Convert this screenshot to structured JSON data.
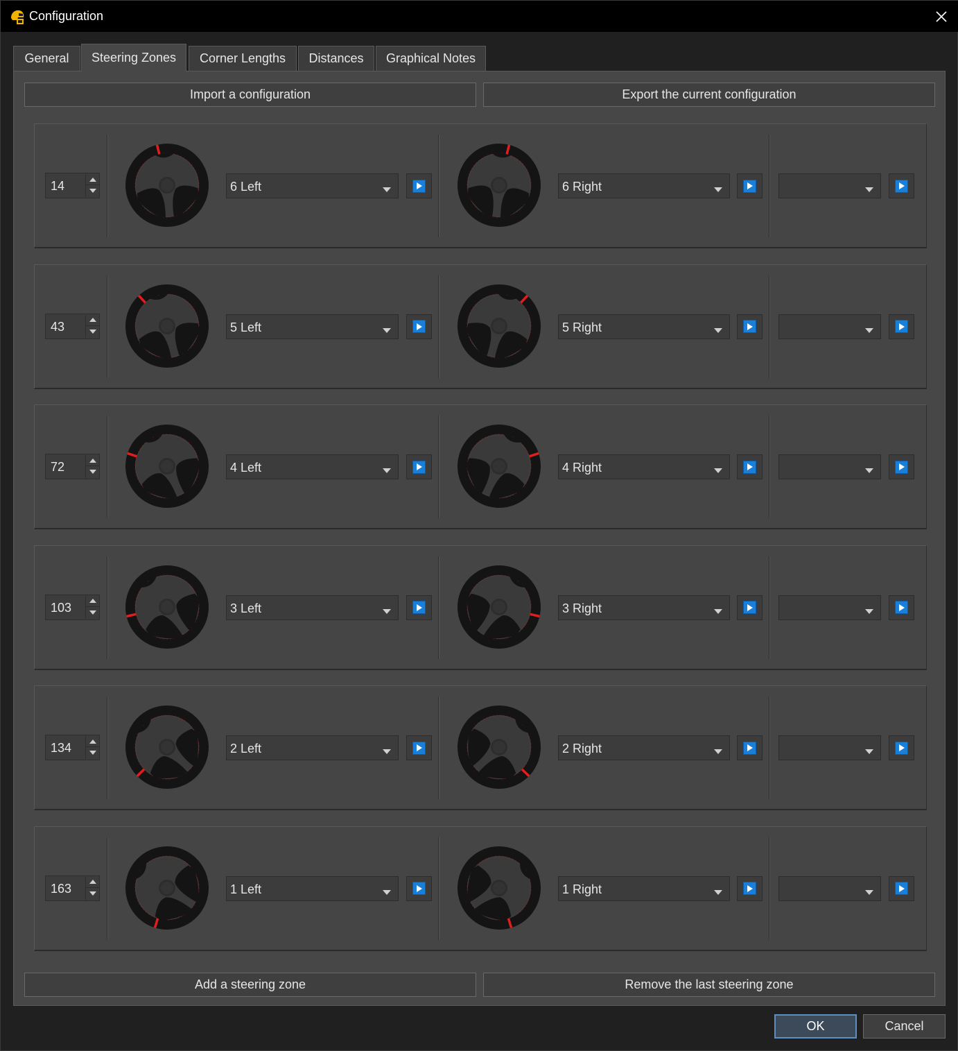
{
  "window": {
    "title": "Configuration"
  },
  "tabs": [
    {
      "label": "General"
    },
    {
      "label": "Steering Zones"
    },
    {
      "label": "Corner Lengths"
    },
    {
      "label": "Distances"
    },
    {
      "label": "Graphical Notes"
    }
  ],
  "active_tab": "Steering Zones",
  "toolbar": {
    "import_label": "Import a configuration",
    "export_label": "Export the current configuration"
  },
  "zones": [
    {
      "angle": "14",
      "left_note": "6 Left",
      "right_note": "6 Right",
      "extra_note": ""
    },
    {
      "angle": "43",
      "left_note": "5 Left",
      "right_note": "5 Right",
      "extra_note": ""
    },
    {
      "angle": "72",
      "left_note": "4 Left",
      "right_note": "4 Right",
      "extra_note": ""
    },
    {
      "angle": "103",
      "left_note": "3 Left",
      "right_note": "3 Right",
      "extra_note": ""
    },
    {
      "angle": "134",
      "left_note": "2 Left",
      "right_note": "2 Right",
      "extra_note": ""
    },
    {
      "angle": "163",
      "left_note": "1 Left",
      "right_note": "1 Right",
      "extra_note": ""
    }
  ],
  "footer": {
    "add_label": "Add a steering zone",
    "remove_label": "Remove the last steering zone"
  },
  "dialog": {
    "ok_label": "OK",
    "cancel_label": "Cancel"
  },
  "colors": {
    "accent": "#1a7fd8",
    "marker": "#e01e1e",
    "titlebar": "#000000",
    "panel": "#474747"
  },
  "icons": {
    "app": "helmet-icon",
    "close": "close-icon",
    "play": "play-icon",
    "dropdown": "chevron-down-icon",
    "wheel": "steering-wheel-icon"
  }
}
